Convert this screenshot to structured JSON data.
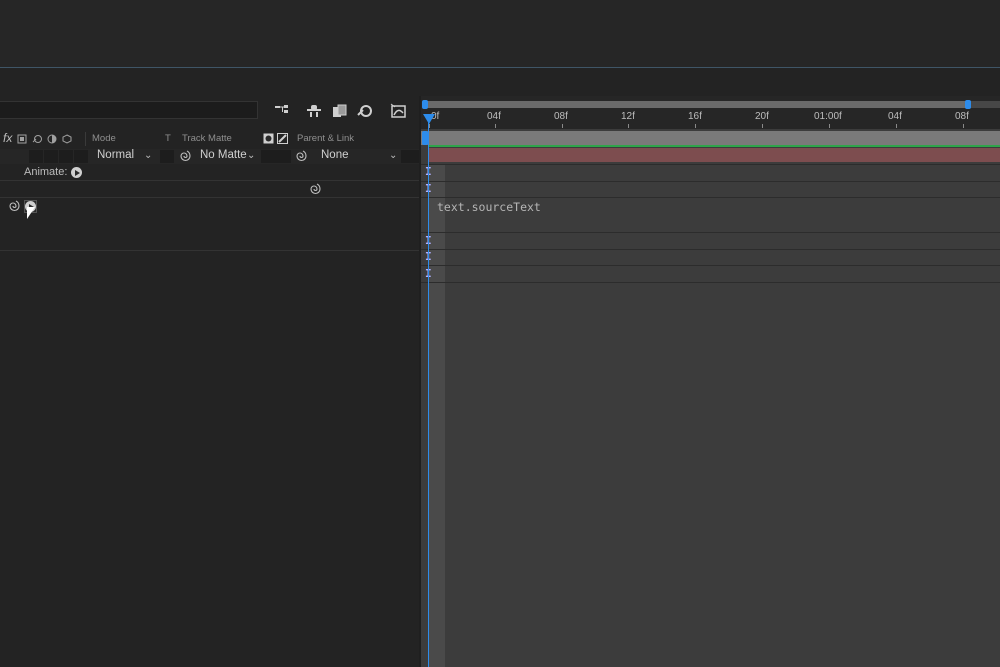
{
  "columns": {
    "fx": "fx",
    "mode": "Mode",
    "t": "T",
    "track_matte": "Track Matte",
    "parent_link": "Parent & Link"
  },
  "layer_row": {
    "mode_value": "Normal",
    "track_matte_value": "No Matte",
    "parent_value": "None"
  },
  "animate_label": "Animate:",
  "ruler": {
    "labels": [
      "0f",
      "04f",
      "08f",
      "12f",
      "16f",
      "20f",
      "01:00f",
      "04f",
      "08f"
    ]
  },
  "expression_text": "text.sourceText",
  "colors": {
    "accent": "#2d8ceb",
    "layer_bar": "#7d4d4f",
    "in_point_line": "#2fa44a"
  }
}
